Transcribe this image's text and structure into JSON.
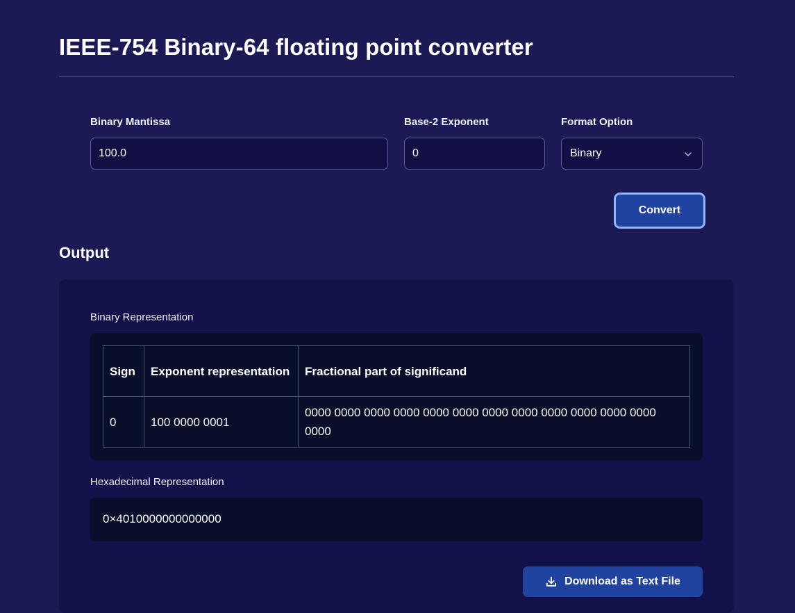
{
  "page": {
    "title": "IEEE-754 Binary-64 floating point converter"
  },
  "form": {
    "mantissa": {
      "label": "Binary Mantissa",
      "value": "100.0"
    },
    "exponent": {
      "label": "Base-2 Exponent",
      "value": "0"
    },
    "format": {
      "label": "Format Option",
      "selected": "Binary",
      "icon": "chevron-down-icon"
    },
    "convert_label": "Convert"
  },
  "output": {
    "heading": "Output",
    "binary": {
      "label": "Binary Representation",
      "headers": [
        "Sign",
        "Exponent representation",
        "Fractional part of significand"
      ],
      "row": [
        "0",
        "100 0000 0001",
        "0000 0000 0000 0000 0000 0000 0000 0000 0000 0000 0000 0000 0000"
      ]
    },
    "hex": {
      "label": "Hexadecimal Representation",
      "value": "0×4010000000000000"
    },
    "download": {
      "label": "Download as Text File",
      "icon": "download-icon"
    }
  },
  "colors": {
    "background": "#1c1a55",
    "panel": "#13114a",
    "code_box": "#090e2b",
    "button": "#2143a0",
    "focus_ring": "#8fb7ff",
    "input_border": "#5a5d97"
  }
}
